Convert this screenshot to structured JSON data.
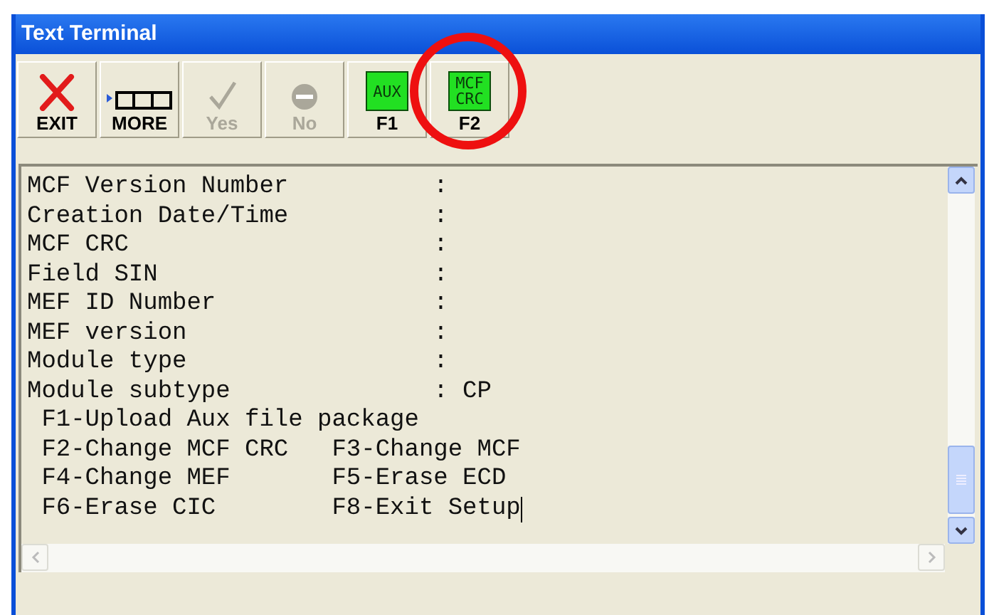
{
  "window": {
    "title": "Text Terminal"
  },
  "toolbar": {
    "buttons": [
      {
        "kind": "exit",
        "label": "EXIT",
        "disabled": false,
        "highlighted": false
      },
      {
        "kind": "more",
        "label": "MORE",
        "disabled": false,
        "highlighted": false
      },
      {
        "kind": "yes",
        "label": "Yes",
        "disabled": true,
        "highlighted": false
      },
      {
        "kind": "no",
        "label": "No",
        "disabled": true,
        "highlighted": false
      },
      {
        "kind": "badge",
        "label": "F1",
        "badge_text": [
          "AUX"
        ],
        "disabled": false,
        "highlighted": false
      },
      {
        "kind": "badge",
        "label": "F2",
        "badge_text": [
          "MCF",
          "CRC"
        ],
        "disabled": false,
        "highlighted": true
      }
    ]
  },
  "terminal": {
    "lines": [
      "MCF Version Number          :",
      "Creation Date/Time          :",
      "MCF CRC                     :",
      "Field SIN                   :",
      "MEF ID Number               :",
      "MEF version                 :",
      "Module type                 :",
      "Module subtype              : CP",
      " F1-Upload Aux file package",
      " F2-Change MCF CRC   F3-Change MCF",
      " F4-Change MEF       F5-Erase ECD",
      " F6-Erase CIC        F8-Exit Setup"
    ],
    "cursor_visible": true
  }
}
